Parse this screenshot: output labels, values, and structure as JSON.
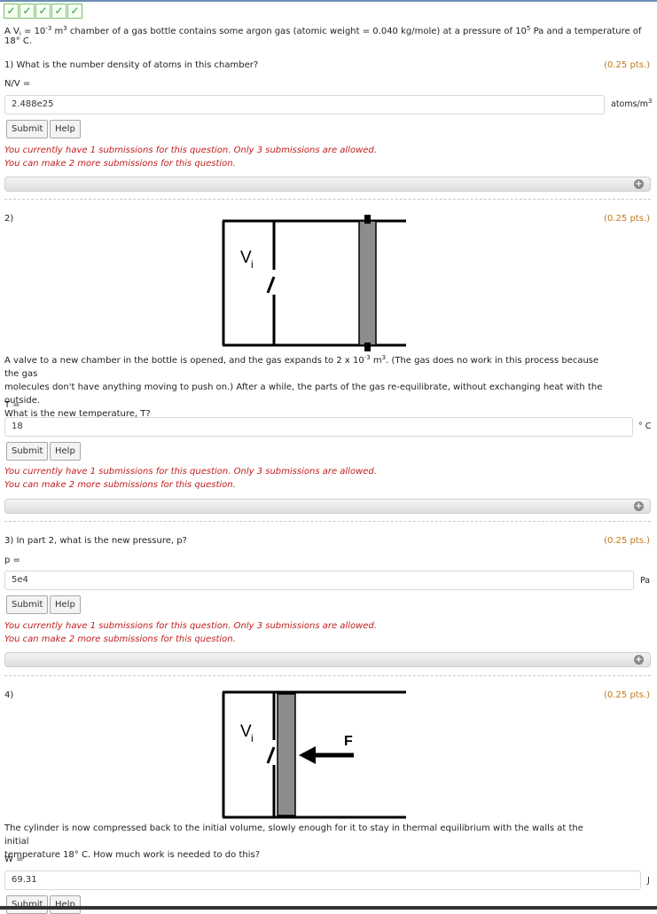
{
  "status": {
    "checks": [
      "✓",
      "✓",
      "✓",
      "✓",
      "✓"
    ]
  },
  "intro": {
    "a": "A V",
    "sub_i": "i",
    "b": " = 10",
    "exp1": "-3",
    "c": " m",
    "exp2": "3",
    "d": " chamber of a gas bottle contains some argon gas (atomic weight = 0.040 kg/mole) at a pressure of 10",
    "exp3": "5",
    "e": " Pa and a temperature of 18° C."
  },
  "q1": {
    "question": "1) What is the number density of atoms in this chamber?",
    "points": "(0.25 pts.)",
    "var": "N/V =",
    "value": "2.488e25",
    "unit_base": "atoms/m",
    "unit_exp": "3",
    "submit": "Submit",
    "help": "Help",
    "msg1": "You currently have 1 submissions for this question. Only 3 submissions are allowed.",
    "msg2": "You can make 2 more submissions for this question.",
    "bar_icon": "+"
  },
  "q2": {
    "number": "2)",
    "points": "(0.25 pts.)",
    "diagram_v": "V",
    "diagram_sub": "i",
    "text_a": "A valve to a new chamber in the bottle is opened, and the gas expands to 2 x 10",
    "text_exp1": "-3",
    "text_b": " m",
    "text_exp2": "3",
    "text_c": ". (The gas does no work in this process because the gas",
    "line2": "molecules don't have anything moving to push on.) After a while, the parts of the gas re-equilibrate, without exchanging heat with the outside.",
    "line3": "What is the new temperature, T?",
    "var": "T =",
    "value": "18",
    "unit": "° C",
    "submit": "Submit",
    "help": "Help",
    "msg1": "You currently have 1 submissions for this question. Only 3 submissions are allowed.",
    "msg2": "You can make 2 more submissions for this question.",
    "bar_icon": "+"
  },
  "q3": {
    "question": "3) In part 2, what is the new pressure, p?",
    "points": "(0.25 pts.)",
    "var": "p =",
    "value": "5e4",
    "unit": "Pa",
    "submit": "Submit",
    "help": "Help",
    "msg1": "You currently have 1 submissions for this question. Only 3 submissions are allowed.",
    "msg2": "You can make 2 more submissions for this question.",
    "bar_icon": "+"
  },
  "q4": {
    "number": "4)",
    "points": "(0.25 pts.)",
    "diagram_v": "V",
    "diagram_sub": "i",
    "diagram_f": "F",
    "line1": "The cylinder is now compressed back to the initial volume, slowly enough for it to stay in thermal equilibrium with the walls at the initial",
    "line2": "temperature 18° C. How much work is needed to do this?",
    "var": "W =",
    "value": "69.31",
    "unit": "J",
    "submit": "Submit",
    "help": "Help"
  }
}
